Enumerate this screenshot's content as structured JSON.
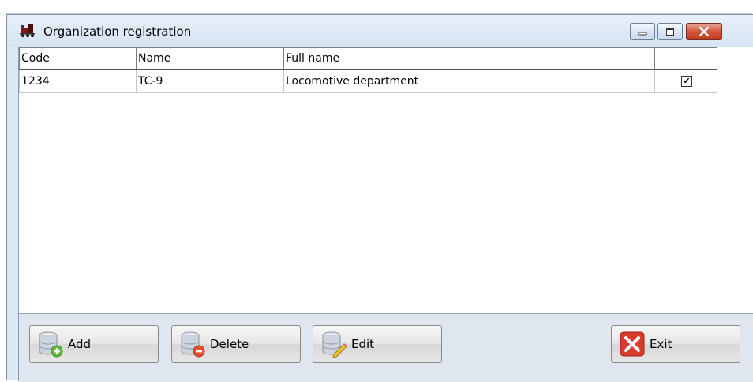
{
  "window": {
    "title": "Organization registration",
    "app_icon": "train-icon",
    "controls": {
      "minimize": "minimize-icon",
      "maximize": "maximize-icon",
      "close": "close-icon"
    }
  },
  "grid": {
    "columns": [
      "Code",
      "Name",
      "Full name",
      ""
    ],
    "rows": [
      {
        "code": "1234",
        "name": "TC-9",
        "full_name": "Locomotive department",
        "checked": "✔"
      }
    ]
  },
  "toolbar": {
    "add_label": "Add",
    "delete_label": "Delete",
    "edit_label": "Edit",
    "exit_label": "Exit"
  },
  "colors": {
    "title_bar": "#dfe9f5",
    "close_button": "#c23a20",
    "exit_icon": "#d93a2b"
  }
}
